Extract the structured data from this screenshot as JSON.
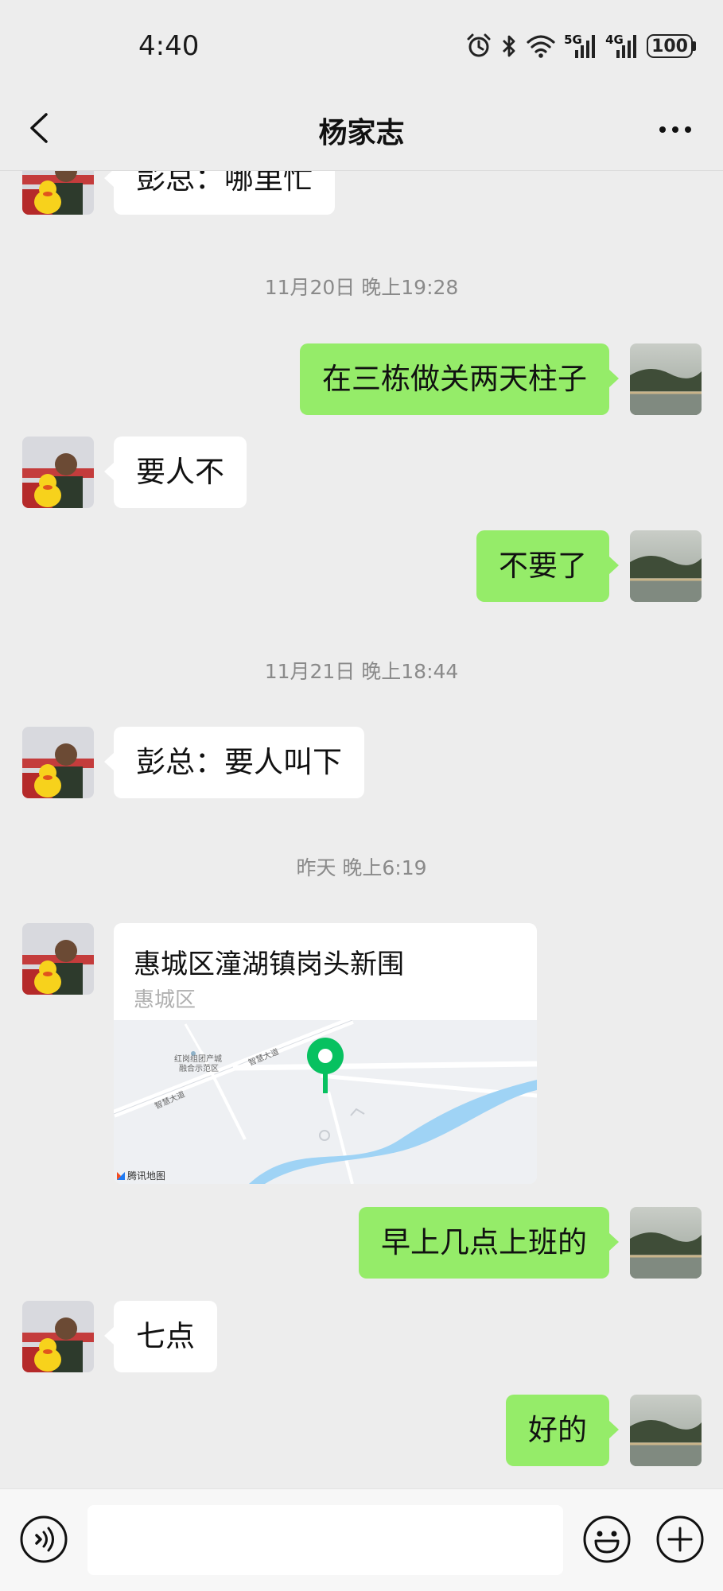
{
  "status_bar": {
    "time": "4:40",
    "battery": "100",
    "network_1": "5G",
    "network_2": "4G"
  },
  "header": {
    "title": "杨家志"
  },
  "messages": [
    {
      "type": "text",
      "from": "other",
      "text": "彭总：哪里忙"
    },
    {
      "type": "timestamp",
      "text": "11月20日 晚上19:28"
    },
    {
      "type": "text",
      "from": "me",
      "text": "在三栋做关两天柱子"
    },
    {
      "type": "text",
      "from": "other",
      "text": "要人不"
    },
    {
      "type": "text",
      "from": "me",
      "text": "不要了"
    },
    {
      "type": "timestamp",
      "text": "11月21日 晚上18:44"
    },
    {
      "type": "text",
      "from": "other",
      "text": "彭总：要人叫下"
    },
    {
      "type": "timestamp",
      "text": "昨天 晚上6:19"
    },
    {
      "type": "location",
      "from": "other",
      "title": "惠城区潼湖镇岗头新围",
      "subtitle": "惠城区",
      "map_labels": [
        "红岗组团产城",
        "融合示范区",
        "智慧大道",
        "智慧大道"
      ],
      "map_brand": "腾讯地图"
    },
    {
      "type": "text",
      "from": "me",
      "text": "早上几点上班的"
    },
    {
      "type": "text",
      "from": "other",
      "text": "七点"
    },
    {
      "type": "text",
      "from": "me",
      "text": "好的"
    }
  ],
  "input": {
    "placeholder": ""
  },
  "colors": {
    "background": "#ededed",
    "outgoing_bubble": "#95ec69",
    "incoming_bubble": "#ffffff",
    "map_pin": "#07c160",
    "river": "#9fd3f5"
  }
}
